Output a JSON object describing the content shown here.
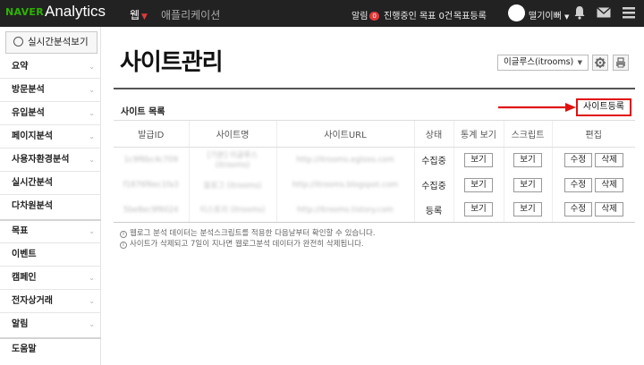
{
  "topbar": {
    "brand": "NAVER",
    "product": "Analytics",
    "tabs": [
      {
        "label": "웹"
      },
      {
        "label": "애플리케이션"
      }
    ],
    "alert_label": "알림",
    "alert_count": "0",
    "goal_text": "진행중인 목표 0건",
    "goal_register": "목표등록",
    "user_name": "떨기이뻐",
    "colors": {
      "bg": "#222222",
      "brand": "#2db400",
      "accent": "#e03a3a"
    }
  },
  "sidebar": {
    "realtime_button": "실시간분석보기",
    "items": [
      {
        "label": "요약",
        "chevron": "⌄"
      },
      {
        "label": "방문분석",
        "chevron": "⌄"
      },
      {
        "label": "유입분석",
        "chevron": "⌄"
      },
      {
        "label": "페이지분석",
        "chevron": "⌄"
      },
      {
        "label": "사용자환경분석",
        "chevron": "⌄"
      },
      {
        "label": "실시간분석",
        "chevron": ""
      },
      {
        "label": "다차원분석",
        "chevron": ""
      },
      {
        "label": "목표",
        "chevron": "⌄"
      },
      {
        "label": "이벤트",
        "chevron": ""
      },
      {
        "label": "캠페인",
        "chevron": "⌄"
      },
      {
        "label": "전자상거래",
        "chevron": "⌄"
      },
      {
        "label": "알림",
        "chevron": "⌄"
      },
      {
        "label": "도움말",
        "chevron": ""
      }
    ]
  },
  "main": {
    "title": "사이트관리",
    "site_select": "이글루스(itrooms)",
    "section_label": "사이트 목록",
    "register_button": "사이트등록",
    "table": {
      "headers": [
        "발급ID",
        "사이트명",
        "사이트URL",
        "상태",
        "통계 보기",
        "스크립트",
        "편집"
      ],
      "rows": [
        {
          "id": "1c9f6bc4c709",
          "name": "[기본] 이글루스 (itrooms)",
          "url": "http://itrooms.egloos.com",
          "status": "수집중",
          "view": "보기",
          "script": "보기",
          "edit": "수정",
          "delete": "삭제"
        },
        {
          "id": "f1876f6ec1fa3",
          "name": "블로그 (itrooms)",
          "url": "http://itrooms.blogspot.com",
          "status": "수집중",
          "view": "보기",
          "script": "보기",
          "edit": "수정",
          "delete": "삭제"
        },
        {
          "id": "5be8ec9f6024",
          "name": "티스토리 (itrooms)",
          "url": "http://itrooms.tistory.com",
          "status": "등록",
          "view": "보기",
          "script": "보기",
          "edit": "수정",
          "delete": "삭제"
        }
      ]
    },
    "notes": [
      "웹로그 분석 데이터는 분석스크립트를 적용한 다음날부터 확인할 수 있습니다.",
      "사이트가 삭제되고 7일이 지나면 웹로그분석 데이터가 완전히 삭제됩니다."
    ]
  }
}
